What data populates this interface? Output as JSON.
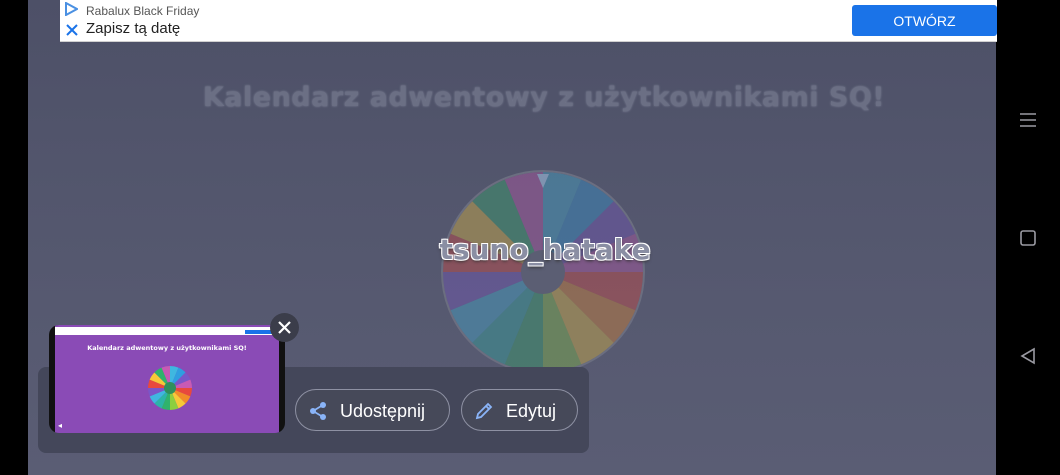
{
  "ad": {
    "sponsor": "Rabalux Black Friday",
    "headline": "Zapisz tą datę",
    "button_label": "OTWÓRZ",
    "accent_color": "#1a73e8"
  },
  "main": {
    "title": "Kalendarz adwentowy z użytkownikami SQ!",
    "winner": "tsuno_hatake"
  },
  "pip": {
    "title": "Kalendarz adwentowy z użytkownikami SQ!",
    "background_color": "#8a4bb6"
  },
  "actions": {
    "share_label": "Udostępnij",
    "edit_label": "Edytuj"
  },
  "icons": {
    "close": "close-icon",
    "share": "share-icon",
    "edit": "pencil-icon",
    "menu": "menu-icon",
    "recents": "square-icon",
    "back": "back-triangle-icon"
  }
}
